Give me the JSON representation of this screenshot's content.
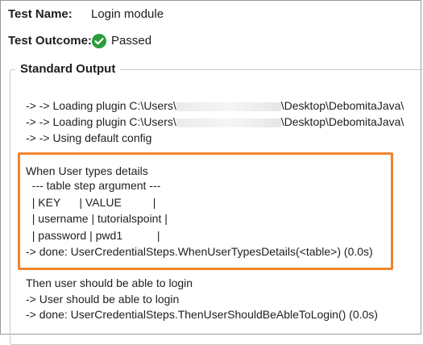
{
  "header": {
    "test_name_label": "Test Name:",
    "test_name_value": "Login module",
    "test_outcome_label": "Test Outcome:",
    "test_outcome_value": "Passed",
    "status_color": "#2a9d3a"
  },
  "output": {
    "title": "Standard Output",
    "plugin_prefix": "-> -> Loading plugin C:\\Users\\",
    "plugin1_suffix": "\\Desktop\\DebomitaJava\\",
    "plugin2_suffix": "\\Desktop\\DebomitaJava\\",
    "default_config": "-> -> Using default config",
    "step_block": [
      "When User types details",
      "  --- table step argument ---",
      "  | KEY      | VALUE          |",
      "  | username | tutorialspoint |",
      "  | password | pwd1           |",
      "-> done: UserCredentialSteps.WhenUserTypesDetails(<table>) (0.0s)"
    ],
    "then_lines": [
      "Then user should be able to login",
      "-> User should be able to login",
      "-> done: UserCredentialSteps.ThenUserShouldBeAbleToLogin() (0.0s)"
    ],
    "highlight_color": "#f0852c"
  }
}
